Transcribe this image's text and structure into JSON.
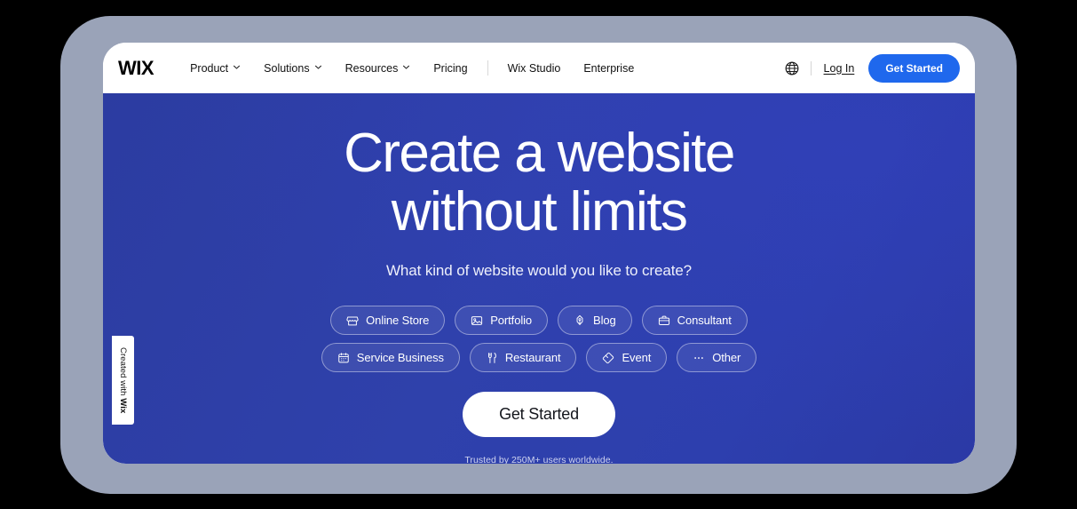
{
  "navbar": {
    "logo": "WIX",
    "links": [
      {
        "label": "Product",
        "has_caret": true,
        "icon": "chevron-down-icon"
      },
      {
        "label": "Solutions",
        "has_caret": true,
        "icon": "chevron-down-icon"
      },
      {
        "label": "Resources",
        "has_caret": true,
        "icon": "chevron-down-icon"
      },
      {
        "label": "Pricing",
        "has_caret": false,
        "icon": ""
      }
    ],
    "secondary_links": [
      {
        "label": "Wix Studio"
      },
      {
        "label": "Enterprise"
      }
    ],
    "globe_icon": "globe-icon",
    "login_label": "Log In",
    "get_started_label": "Get Started",
    "accent_color": "#1F68ED"
  },
  "hero": {
    "title_line1": "Create a website",
    "title_line2": "without limits",
    "subtitle": "What kind of website would you like to create?",
    "background_color": "#2F41AB",
    "chips_row1": [
      {
        "label": "Online Store",
        "icon": "store-icon"
      },
      {
        "label": "Portfolio",
        "icon": "image-icon"
      },
      {
        "label": "Blog",
        "icon": "pen-nib-icon"
      },
      {
        "label": "Consultant",
        "icon": "briefcase-icon"
      }
    ],
    "chips_row2": [
      {
        "label": "Service Business",
        "icon": "calendar-icon"
      },
      {
        "label": "Restaurant",
        "icon": "cutlery-icon"
      },
      {
        "label": "Event",
        "icon": "ticket-icon"
      },
      {
        "label": "Other",
        "icon": "ellipsis-icon"
      }
    ],
    "cta_label": "Get Started",
    "trust_text": "Trusted by 250M+ users worldwide."
  },
  "badge": {
    "prefix": "Created with ",
    "brand": "Wix"
  }
}
